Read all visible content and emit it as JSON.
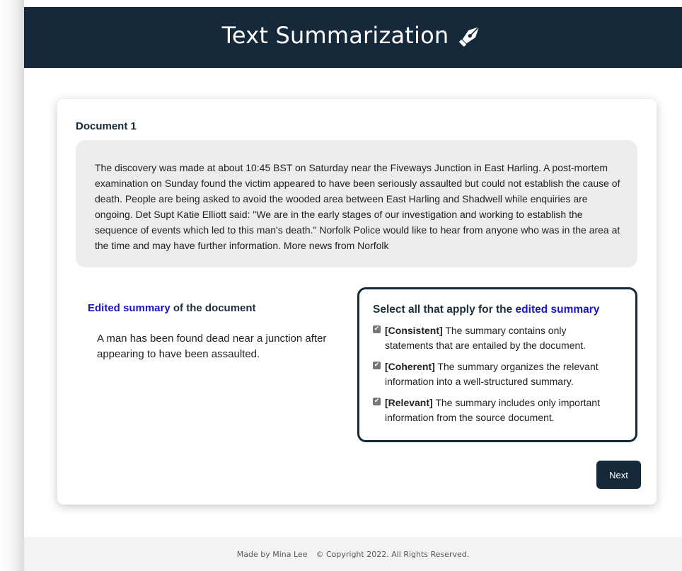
{
  "header": {
    "title": "Text Summarization",
    "icon": "pen-nib-icon"
  },
  "document": {
    "title": "Document 1",
    "text": "The discovery was made at about 10:45 BST on Saturday near the Fiveways Junction in East Harling. A post-mortem examination on Sunday found the victim appeared to have been seriously assaulted but could not establish the cause of death. People are being asked to avoid the wooded area between East Harling and Shadwell while enquiries are ongoing. Det Supt Katie Elliott said: \"We are in the early stages of our investigation and working to establish the sequence of events which led to this man's death.\" Norfolk Police would like to hear from anyone who was in the area at the time and may have further information. More news from Norfolk"
  },
  "summary": {
    "heading_accent": "Edited summary",
    "heading_rest": " of the document",
    "text": "A man has been found dead near a junction after appearing to have been assaulted."
  },
  "criteria": {
    "heading_prefix": "Select all that apply for the ",
    "heading_accent": "edited summary",
    "items": [
      {
        "tag": "[Consistent]",
        "text": " The summary contains only statements that are entailed by the document.",
        "checked": true
      },
      {
        "tag": "[Coherent]",
        "text": " The summary organizes the relevant information into a well-structured summary.",
        "checked": true
      },
      {
        "tag": "[Relevant]",
        "text": " The summary includes only important information from the source document.",
        "checked": true
      }
    ]
  },
  "actions": {
    "next_label": "Next"
  },
  "footer": {
    "made_by": "Made by Mina Lee",
    "copyright": "© Copyright 2022. All Rights Reserved."
  },
  "colors": {
    "header_bg": "#16293a",
    "accent": "#1a14c9",
    "doc_box_bg": "#ececec",
    "footer_bg": "#f3f3f3"
  }
}
